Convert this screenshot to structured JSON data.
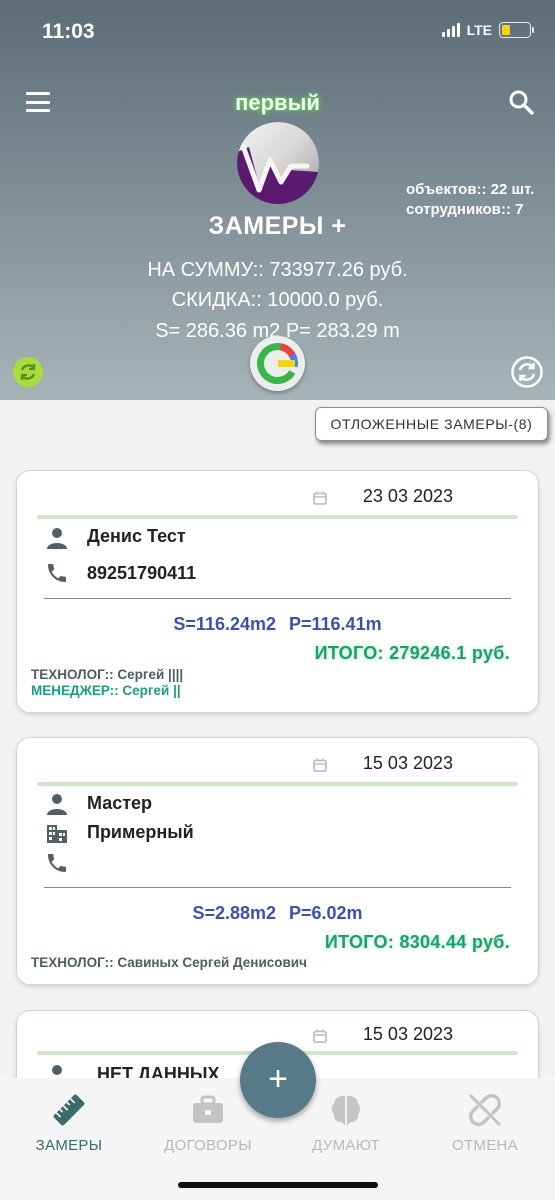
{
  "status_bar": {
    "time": "11:03",
    "network": "LTE",
    "battery_color": "#f5d31a"
  },
  "header": {
    "top_title": "первый",
    "app_title": "ЗАМЕРЫ +",
    "objects_count": "объектов:: 22 шт.",
    "employees_count": "сотрудников:: 7",
    "sum_line": "НА СУММУ:: 733977.26 руб.",
    "discount_line": "СКИДКА:: 10000.0 руб.",
    "area_line": "S= 286.36 m2 P= 283.29 m",
    "icons": {
      "menu": "menu-icon",
      "search": "search-icon",
      "sync_left": "sync-icon",
      "sync_right": "sync-icon",
      "center": "google-g-icon"
    }
  },
  "deferred_button": {
    "label": "ОТЛОЖЕННЫЕ  ЗАМЕРЫ-(8)"
  },
  "cards": [
    {
      "date": "23 03 2023",
      "name": "Денис Тест",
      "phone": "89251790411",
      "sp": "S=116.24m2   P=116.41m",
      "total": "ИТОГО: 279246.1 руб.",
      "technologist": "ТЕХНОЛОГ:: Сергей ||||",
      "manager": "МЕНЕДЖЕР:: Сергей ||"
    },
    {
      "date": "15 03 2023",
      "name": "Мастер",
      "address": "Примерный",
      "phone": "",
      "sp": "S=2.88m2   P=6.02m",
      "total": "ИТОГО: 8304.44 руб.",
      "technologist": "ТЕХНОЛОГ:: Савиных Сергей Денисович"
    },
    {
      "date": "15 03 2023",
      "name": "НЕТ ДАННЫХ"
    }
  ],
  "colors": {
    "accent_blue": "#3a52a8",
    "accent_green": "#1f9c7c",
    "fab": "#587a88",
    "active_nav": "#3a6c6c"
  },
  "fab": {
    "label": "+"
  },
  "bottom_nav": [
    {
      "label": "ЗАМЕРЫ",
      "icon": "ruler-icon",
      "active": true
    },
    {
      "label": "ДОГОВОРЫ",
      "icon": "briefcase-icon",
      "active": false
    },
    {
      "label": "ДУМАЮТ",
      "icon": "brain-icon",
      "active": false
    },
    {
      "label": "ОТМЕНА",
      "icon": "broken-link-icon",
      "active": false
    }
  ]
}
